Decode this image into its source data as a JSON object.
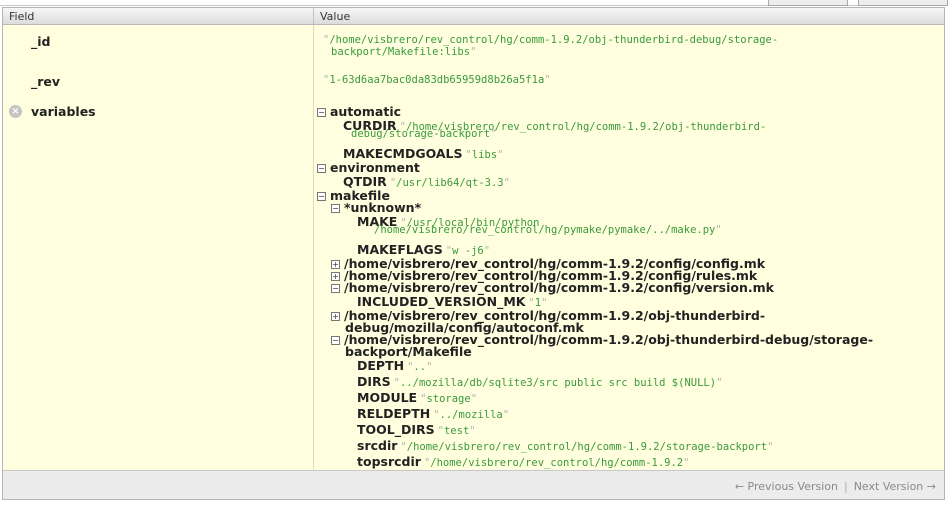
{
  "header": {
    "field": "Field",
    "value": "Value"
  },
  "fields": {
    "id": {
      "name": "_id",
      "value_line1": "/home/visbrero/rev_control/hg/comm-1.9.2/obj-thunderbird-debug/storage-",
      "value_line2": "backport/Makefile:libs"
    },
    "rev": {
      "name": "_rev",
      "value": "1-63d6aa7bac0da83db65959d8b26a5f1a"
    },
    "variables": {
      "name": "variables"
    }
  },
  "tree": {
    "automatic": {
      "label": "automatic",
      "curdir_key": "CURDIR",
      "curdir_line1": "/home/visbrero/rev_control/hg/comm-1.9.2/obj-thunderbird-",
      "curdir_line2": "debug/storage-backport",
      "makecmdgoals_key": "MAKECMDGOALS",
      "makecmdgoals_val": "libs"
    },
    "environment": {
      "label": "environment",
      "qtdir_key": "QTDIR",
      "qtdir_val": "/usr/lib64/qt-3.3"
    },
    "makefile": {
      "label": "makefile",
      "unknown": {
        "label": "*unknown*",
        "make_key": "MAKE",
        "make_line1": "/usr/local/bin/python",
        "make_line2": "/home/visbrero/rev_control/hg/pymake/pymake/../make.py",
        "makeflags_key": "MAKEFLAGS",
        "makeflags_val": "w -j6"
      },
      "config_mk": "/home/visbrero/rev_control/hg/comm-1.9.2/config/config.mk",
      "rules_mk": "/home/visbrero/rev_control/hg/comm-1.9.2/config/rules.mk",
      "version_mk": "/home/visbrero/rev_control/hg/comm-1.9.2/config/version.mk",
      "included_version_key": "INCLUDED_VERSION_MK",
      "included_version_val": "1",
      "autoconf_line1": "/home/visbrero/rev_control/hg/comm-1.9.2/obj-thunderbird-",
      "autoconf_line2": "debug/mozilla/config/autoconf.mk",
      "storage_line1": "/home/visbrero/rev_control/hg/comm-1.9.2/obj-thunderbird-debug/storage-",
      "storage_line2": "backport/Makefile",
      "storage_vars": {
        "depth_key": "DEPTH",
        "depth_val": "..",
        "dirs_key": "DIRS",
        "dirs_val": "../mozilla/db/sqlite3/src public src build $(NULL)",
        "module_key": "MODULE",
        "module_val": "storage",
        "reldepth_key": "RELDEPTH",
        "reldepth_val": "../mozilla",
        "tooldirs_key": "TOOL_DIRS",
        "tooldirs_val": "test",
        "srcdir_key": "srcdir",
        "srcdir_val": "/home/visbrero/rev_control/hg/comm-1.9.2/storage-backport",
        "topsrcdir_key": "topsrcdir",
        "topsrcdir_val": "/home/visbrero/rev_control/hg/comm-1.9.2"
      }
    }
  },
  "toggles": {
    "expanded": "−",
    "collapsed": "+"
  },
  "remove_icon": "×",
  "footer": {
    "prev": "← Previous Version",
    "separator": "|",
    "next": "Next Version →"
  }
}
